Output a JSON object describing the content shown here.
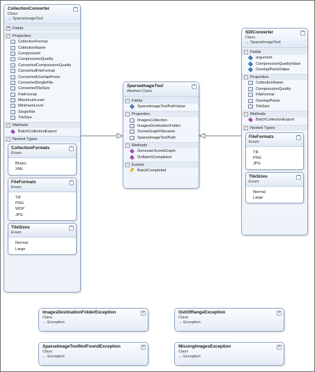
{
  "labels": {
    "fields": "Fields",
    "properties": "Properties",
    "methods": "Methods",
    "events": "Events",
    "nested_types": "Nested Types"
  },
  "collection_converter": {
    "name": "CollectionConverter",
    "kind": "Class",
    "base": "→ SparseImageTool",
    "properties": [
      "CollectionFormat",
      "CollectionName",
      "Compressed",
      "CompressionQuality",
      "ConvertedCompressionQuality",
      "ConvertedFileFormat",
      "ConvertedOverlapPixels",
      "ConvertedSingleFile",
      "ConvertedTileSize",
      "FileFormat",
      "MaximumLevel",
      "MinimumLevel",
      "SingleFile",
      "TileSize"
    ],
    "methods": [
      "BatchCollectionExport"
    ],
    "nested": [
      {
        "name": "CollectionFormats",
        "kind": "Enum",
        "items": [
          "Binary",
          "XML"
        ]
      },
      {
        "name": "FileFormats",
        "kind": "Enum",
        "items": [
          "TIF",
          "PNG",
          "WDP",
          "JPG"
        ]
      },
      {
        "name": "TileSizes",
        "kind": "Enum",
        "items": [
          "Normal",
          "Large"
        ]
      }
    ]
  },
  "sparse_image_tool": {
    "name": "SparseImageTool",
    "kind": "Abstract Class",
    "fields": [
      "SparseImageToolPathValue"
    ],
    "properties": [
      "ImagesCollection",
      "ImagesDestinationFolder",
      "SceneGraphFilename",
      "SparseImageToolPath"
    ],
    "methods": [
      "GenerateSceneGraph",
      "OnBatchCompleted"
    ],
    "events": [
      "BatchCompleted"
    ]
  },
  "sdi_converter": {
    "name": "SDIConverter",
    "kind": "Class",
    "base": "→ SparseImageTool",
    "fields": [
      "argument",
      "CompressionQualityValue",
      "OverlapPixelsValue"
    ],
    "properties": [
      "CollectionName",
      "CompressionQuality",
      "FileFormat",
      "OverlapPixels",
      "TileSize"
    ],
    "methods": [
      "BatchCollectionExport"
    ],
    "nested": [
      {
        "name": "FileFormats",
        "kind": "Enum",
        "items": [
          "TIF",
          "PNG",
          "JPG"
        ]
      },
      {
        "name": "TileSizes",
        "kind": "Enum",
        "items": [
          "Normal",
          "Large"
        ]
      }
    ]
  },
  "exceptions": [
    {
      "name": "ImagesDestinationFolderException",
      "kind": "Class",
      "base": "→ Exception"
    },
    {
      "name": "OutOfRangeException",
      "kind": "Class",
      "base": "→ Exception"
    },
    {
      "name": "SparseImageToolNotFoundException",
      "kind": "Class",
      "base": "→ Exception"
    },
    {
      "name": "MissingImagesException",
      "kind": "Class",
      "base": "→ Exception"
    }
  ]
}
